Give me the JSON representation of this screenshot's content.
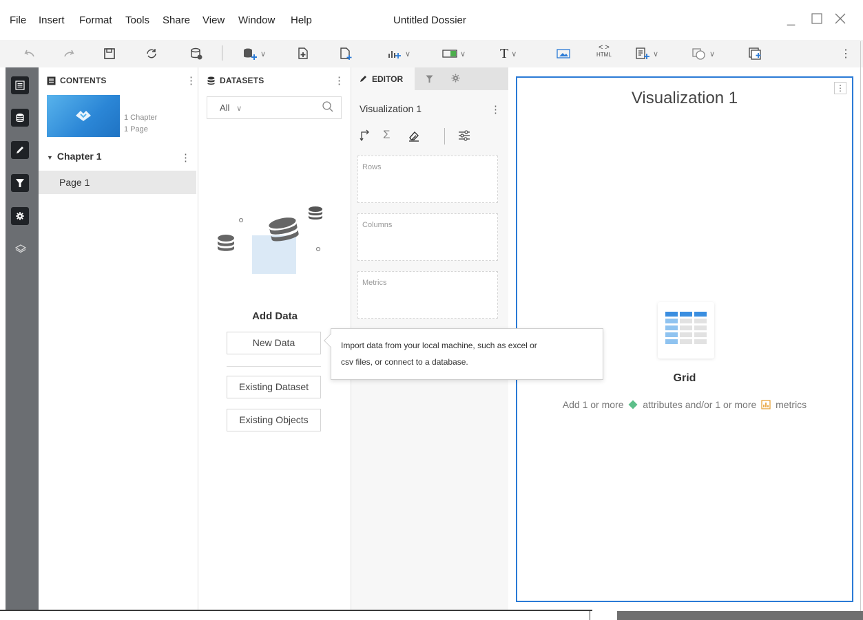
{
  "menubar": {
    "items": [
      "File",
      "Insert",
      "Format",
      "Tools",
      "Share",
      "View",
      "Window",
      "Help"
    ],
    "window_title": "Untitled Dossier"
  },
  "toolbar": {
    "html_label": "HTML"
  },
  "contents": {
    "header": "CONTENTS",
    "chapter_count": "1 Chapter",
    "page_count": "1 Page",
    "chapter": "Chapter 1",
    "page": "Page 1"
  },
  "datasets": {
    "header": "DATASETS",
    "filter_value": "All",
    "add_data_title": "Add Data",
    "new_data": "New Data",
    "existing_dataset": "Existing Dataset",
    "existing_objects": "Existing Objects"
  },
  "editor": {
    "tab": "EDITOR",
    "viz_name": "Visualization 1",
    "rows": "Rows",
    "columns": "Columns",
    "metrics": "Metrics"
  },
  "tooltip": {
    "line1": "Import data from your local machine, such as excel or",
    "line2": "csv files, or connect to a database."
  },
  "canvas": {
    "title": "Visualization 1",
    "grid_label": "Grid",
    "hint_part1": "Add 1 or more",
    "hint_part2": "attributes and/or 1 or more",
    "hint_part3": "metrics"
  },
  "colors": {
    "accent": "#2a7ad6",
    "rail": "#6b6e72",
    "attribute": "#5cbf8a",
    "metric": "#e8a33a"
  }
}
